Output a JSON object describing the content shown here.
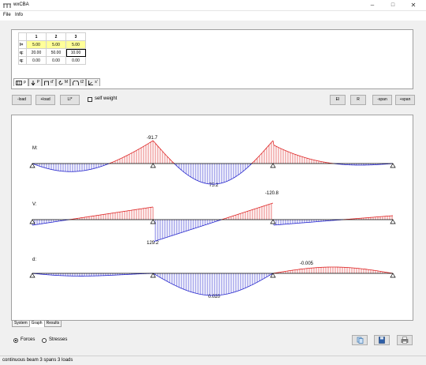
{
  "window": {
    "title": "wxCBA"
  },
  "menu": [
    "File",
    "Info"
  ],
  "input_grid": {
    "columns": [
      "1",
      "2",
      "3"
    ],
    "rows": [
      {
        "label": "l=",
        "values": [
          "5.00",
          "5.00",
          "5.00"
        ]
      },
      {
        "label": "q:",
        "values": [
          "20.00",
          "50.00",
          "10.00"
        ]
      },
      {
        "label": "q:",
        "values": [
          "0.00",
          "0.00",
          "0.00"
        ]
      }
    ]
  },
  "tool_tabs": [
    "p",
    "P",
    "d'",
    "M",
    "t2",
    "s'"
  ],
  "buttons": {
    "minus_load": "-load",
    "plus_load": "+load",
    "li": "LI*",
    "ei": "EI",
    "r": "R",
    "minus_span": "-span",
    "plus_span": "+span"
  },
  "self_weight": {
    "label": "self weight",
    "checked": false
  },
  "diagrams": [
    {
      "label": "M:",
      "min_value": "-91.7",
      "max_value": "75.2"
    },
    {
      "label": "V:",
      "min_value": "-120.8",
      "max_value": "129.2"
    },
    {
      "label": "d:",
      "min_value": "-0.005",
      "max_value": "0.020"
    }
  ],
  "bottom_tabs": [
    "System",
    "Graph",
    "Results"
  ],
  "active_tab": "Graph",
  "output_mode": {
    "options": [
      "Forces",
      "Stresses"
    ],
    "selected": "Forces"
  },
  "status": "continuous beam 3 spans 3 loads",
  "colors": {
    "positive": "#2222cc",
    "negative": "#dd2222",
    "highlight": "#ffff99"
  }
}
